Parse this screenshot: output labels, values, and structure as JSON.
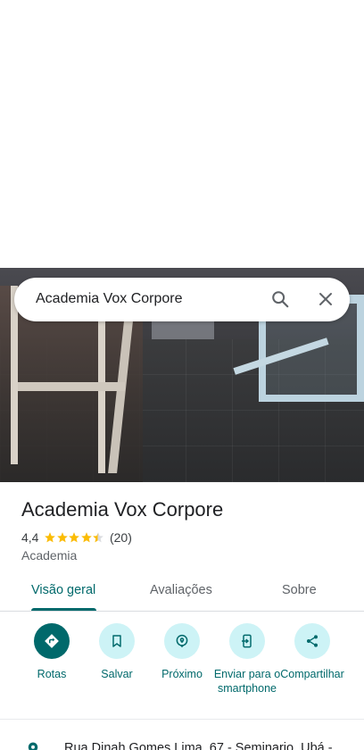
{
  "search": {
    "query": "Academia Vox Corpore"
  },
  "place": {
    "name": "Academia Vox Corpore",
    "rating": "4,4",
    "rating_value": 4.4,
    "review_count": "(20)",
    "category": "Academia"
  },
  "tabs": [
    {
      "label": "Visão geral",
      "active": true
    },
    {
      "label": "Avaliações",
      "active": false
    },
    {
      "label": "Sobre",
      "active": false
    }
  ],
  "actions": [
    {
      "label": "Rotas",
      "icon": "directions-icon"
    },
    {
      "label": "Salvar",
      "icon": "bookmark-icon"
    },
    {
      "label": "Próximo",
      "icon": "nearby-icon"
    },
    {
      "label": "Enviar para o smartphone",
      "icon": "send-to-phone-icon"
    },
    {
      "label": "Compartilhar",
      "icon": "share-icon"
    }
  ],
  "address": {
    "text": "Rua Dinah Gomes Lima, 67 - Seminario, Ubá -"
  },
  "colors": {
    "accent": "#00696b",
    "action_bg": "#cdf3f6",
    "star": "#fbbc04"
  }
}
